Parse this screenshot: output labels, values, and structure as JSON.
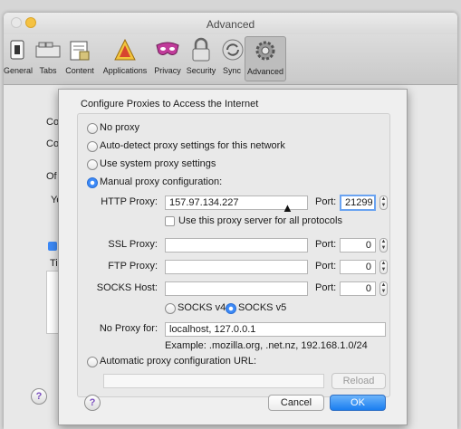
{
  "window": {
    "title": "Advanced"
  },
  "toolbar": {
    "items": [
      {
        "label": "General",
        "icon": "switch-icon"
      },
      {
        "label": "Tabs",
        "icon": "tabs-icon"
      },
      {
        "label": "Content",
        "icon": "content-icon"
      },
      {
        "label": "Applications",
        "icon": "applications-icon"
      },
      {
        "label": "Privacy",
        "icon": "privacy-mask-icon"
      },
      {
        "label": "Security",
        "icon": "padlock-icon"
      },
      {
        "label": "Sync",
        "icon": "sync-icon"
      },
      {
        "label": "Advanced",
        "icon": "gear-icon"
      }
    ],
    "selected": "Advanced"
  },
  "background_fragments": [
    "Co",
    "Co",
    "Of",
    "Yo",
    "Ti"
  ],
  "dialog": {
    "title": "Configure Proxies to Access the Internet",
    "options": {
      "no_proxy": "No proxy",
      "auto_detect": "Auto-detect proxy settings for this network",
      "system": "Use system proxy settings",
      "manual": "Manual proxy configuration:",
      "auto_url": "Automatic proxy configuration URL:"
    },
    "selected_option": "manual",
    "http": {
      "label": "HTTP Proxy:",
      "value": "157.97.134.227",
      "port_label": "Port:",
      "port": "21299"
    },
    "use_for_all": "Use this proxy server for all protocols",
    "ssl": {
      "label": "SSL Proxy:",
      "value": "",
      "port_label": "Port:",
      "port": "0"
    },
    "ftp": {
      "label": "FTP Proxy:",
      "value": "",
      "port_label": "Port:",
      "port": "0"
    },
    "socks": {
      "label": "SOCKS Host:",
      "value": "",
      "port_label": "Port:",
      "port": "0"
    },
    "socks_v4": "SOCKS v4",
    "socks_v5": "SOCKS v5",
    "socks_selected": "v5",
    "no_proxy_for": {
      "label": "No Proxy for:",
      "value": "localhost, 127.0.0.1"
    },
    "example": "Example: .mozilla.org, .net.nz, 192.168.1.0/24",
    "auto_url_value": "",
    "reload": "Reload",
    "cancel": "Cancel",
    "ok": "OK",
    "help": "?"
  },
  "colors": {
    "accent": "#3d8af7",
    "help_purple": "#7b4fbf"
  }
}
